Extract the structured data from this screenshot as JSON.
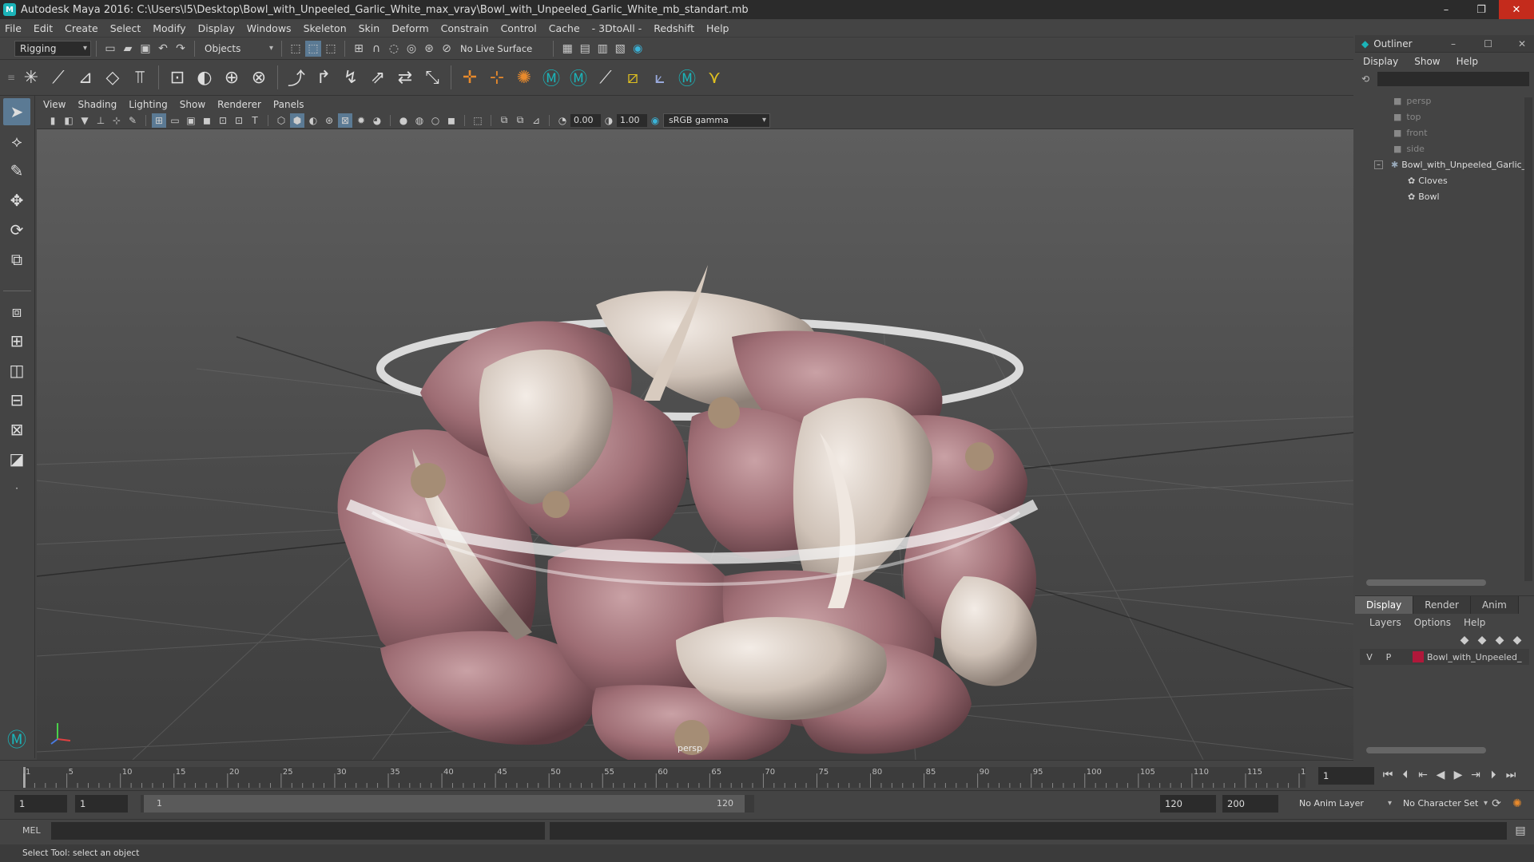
{
  "window": {
    "title": "Autodesk Maya 2016: C:\\Users\\l5\\Desktop\\Bowl_with_Unpeeled_Garlic_White_max_vray\\Bowl_with_Unpeeled_Garlic_White_mb_standart.mb",
    "minimize": "–",
    "restore": "❐",
    "close": "✕"
  },
  "menubar": [
    "File",
    "Edit",
    "Create",
    "Select",
    "Modify",
    "Display",
    "Windows",
    "Skeleton",
    "Skin",
    "Deform",
    "Constrain",
    "Control",
    "Cache",
    "- 3DtoAll -",
    "Redshift",
    "Help"
  ],
  "statusline": {
    "menuset": "Rigging",
    "selection_mode": "Objects",
    "live_surface": "No Live Surface"
  },
  "viewport": {
    "menu": [
      "View",
      "Shading",
      "Lighting",
      "Show",
      "Renderer",
      "Panels"
    ],
    "exposure": "0.00",
    "gamma": "1.00",
    "color_space": "sRGB gamma",
    "camera_label": "persp"
  },
  "outliner": {
    "title": "Outliner",
    "menu": [
      "Display",
      "Show",
      "Help"
    ],
    "items": [
      {
        "label": "persp",
        "dim": true
      },
      {
        "label": "top",
        "dim": true
      },
      {
        "label": "front",
        "dim": true
      },
      {
        "label": "side",
        "dim": true
      },
      {
        "label": "Bowl_with_Unpeeled_Garlic_",
        "dim": false
      },
      {
        "label": "Cloves",
        "dim": false
      },
      {
        "label": "Bowl",
        "dim": false
      }
    ]
  },
  "layers": {
    "tabs": [
      "Display",
      "Render",
      "Anim"
    ],
    "menu": [
      "Layers",
      "Options",
      "Help"
    ],
    "row": {
      "v": "V",
      "p": "P",
      "name": "Bowl_with_Unpeeled_",
      "color": "#b0183a"
    }
  },
  "timeline": {
    "ticks": [
      "1",
      "5",
      "10",
      "15",
      "20",
      "25",
      "30",
      "35",
      "40",
      "45",
      "50",
      "55",
      "60",
      "65",
      "70",
      "75",
      "80",
      "85",
      "90",
      "95",
      "100",
      "105",
      "110",
      "115",
      "120"
    ],
    "current_frame": "1"
  },
  "range": {
    "start": "1",
    "playback_start": "1",
    "slider_start": "1",
    "slider_end": "120",
    "playback_end": "120",
    "end": "200",
    "anim_layer": "No Anim Layer",
    "character_set": "No Character Set"
  },
  "command": {
    "lang": "MEL"
  },
  "help_line": "Select Tool: select an object"
}
